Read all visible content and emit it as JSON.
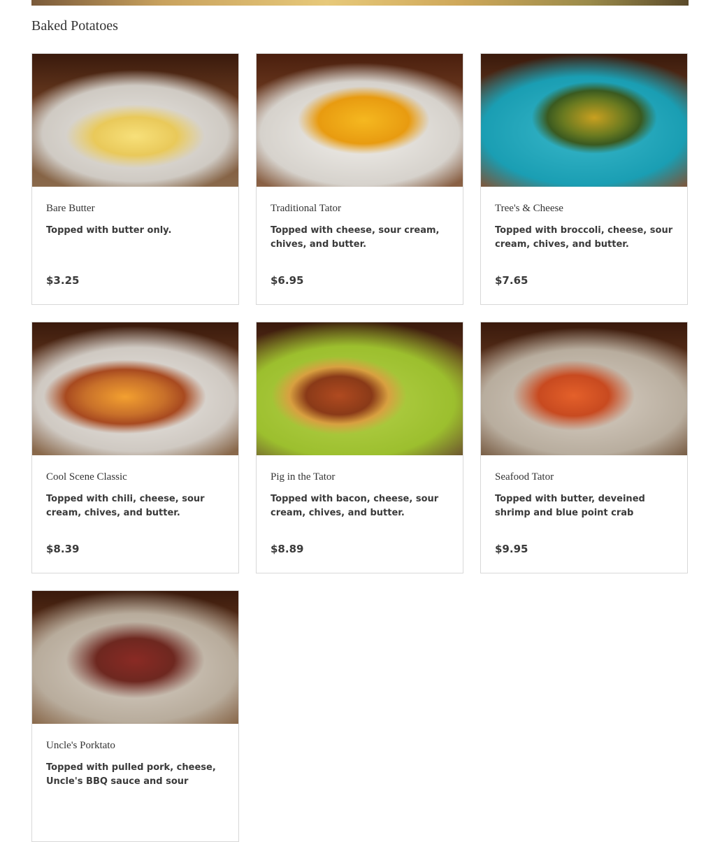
{
  "section": {
    "title": "Baked Potatoes"
  },
  "items": [
    {
      "name": "Bare Butter",
      "description": "Topped with butter only.",
      "price": "$3.25"
    },
    {
      "name": "Traditional Tator",
      "description": "Topped with cheese, sour cream, chives, and butter.",
      "price": "$6.95"
    },
    {
      "name": "Tree's & Cheese",
      "description": "Topped with broccoli, cheese, sour cream, chives, and butter.",
      "price": "$7.65"
    },
    {
      "name": "Cool Scene Classic",
      "description": "Topped with chili, cheese, sour cream, chives, and butter.",
      "price": "$8.39"
    },
    {
      "name": "Pig in the Tator",
      "description": "Topped with bacon, cheese, sour cream, chives, and butter.",
      "price": "$8.89"
    },
    {
      "name": "Seafood Tator",
      "description": "Topped with butter, deveined shrimp and blue point crab étouffée, and…",
      "price": "$9.95"
    },
    {
      "name": "Uncle's Porktato",
      "description": "Topped with pulled pork, cheese, Uncle's BBQ sauce and sour cream.",
      "price": ""
    }
  ]
}
